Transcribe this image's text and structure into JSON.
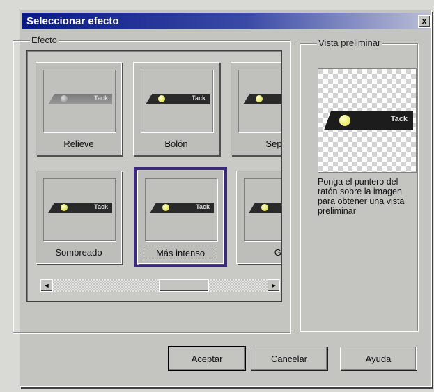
{
  "dialog": {
    "title": "Seleccionar efecto",
    "close_label": "x"
  },
  "efecto_group": {
    "label": "Efecto",
    "tiles": [
      {
        "label": "Relieve",
        "selected": false
      },
      {
        "label": "Bolón",
        "selected": false
      },
      {
        "label": "Sep",
        "selected": false
      },
      {
        "label": "Sombreado",
        "selected": false
      },
      {
        "label": "Más intenso",
        "selected": true
      },
      {
        "label": "Gr",
        "selected": false
      }
    ],
    "thumb_text": "Tack"
  },
  "scrollbar": {
    "left_arrow": "◄",
    "right_arrow": "►"
  },
  "preview_group": {
    "label": "Vista preliminar",
    "thumb_text": "Tack",
    "hint": "Ponga el puntero del ratón sobre la imagen para obtener una vista preliminar"
  },
  "buttons": {
    "ok": "Aceptar",
    "cancel": "Cancelar",
    "help": "Ayuda"
  }
}
